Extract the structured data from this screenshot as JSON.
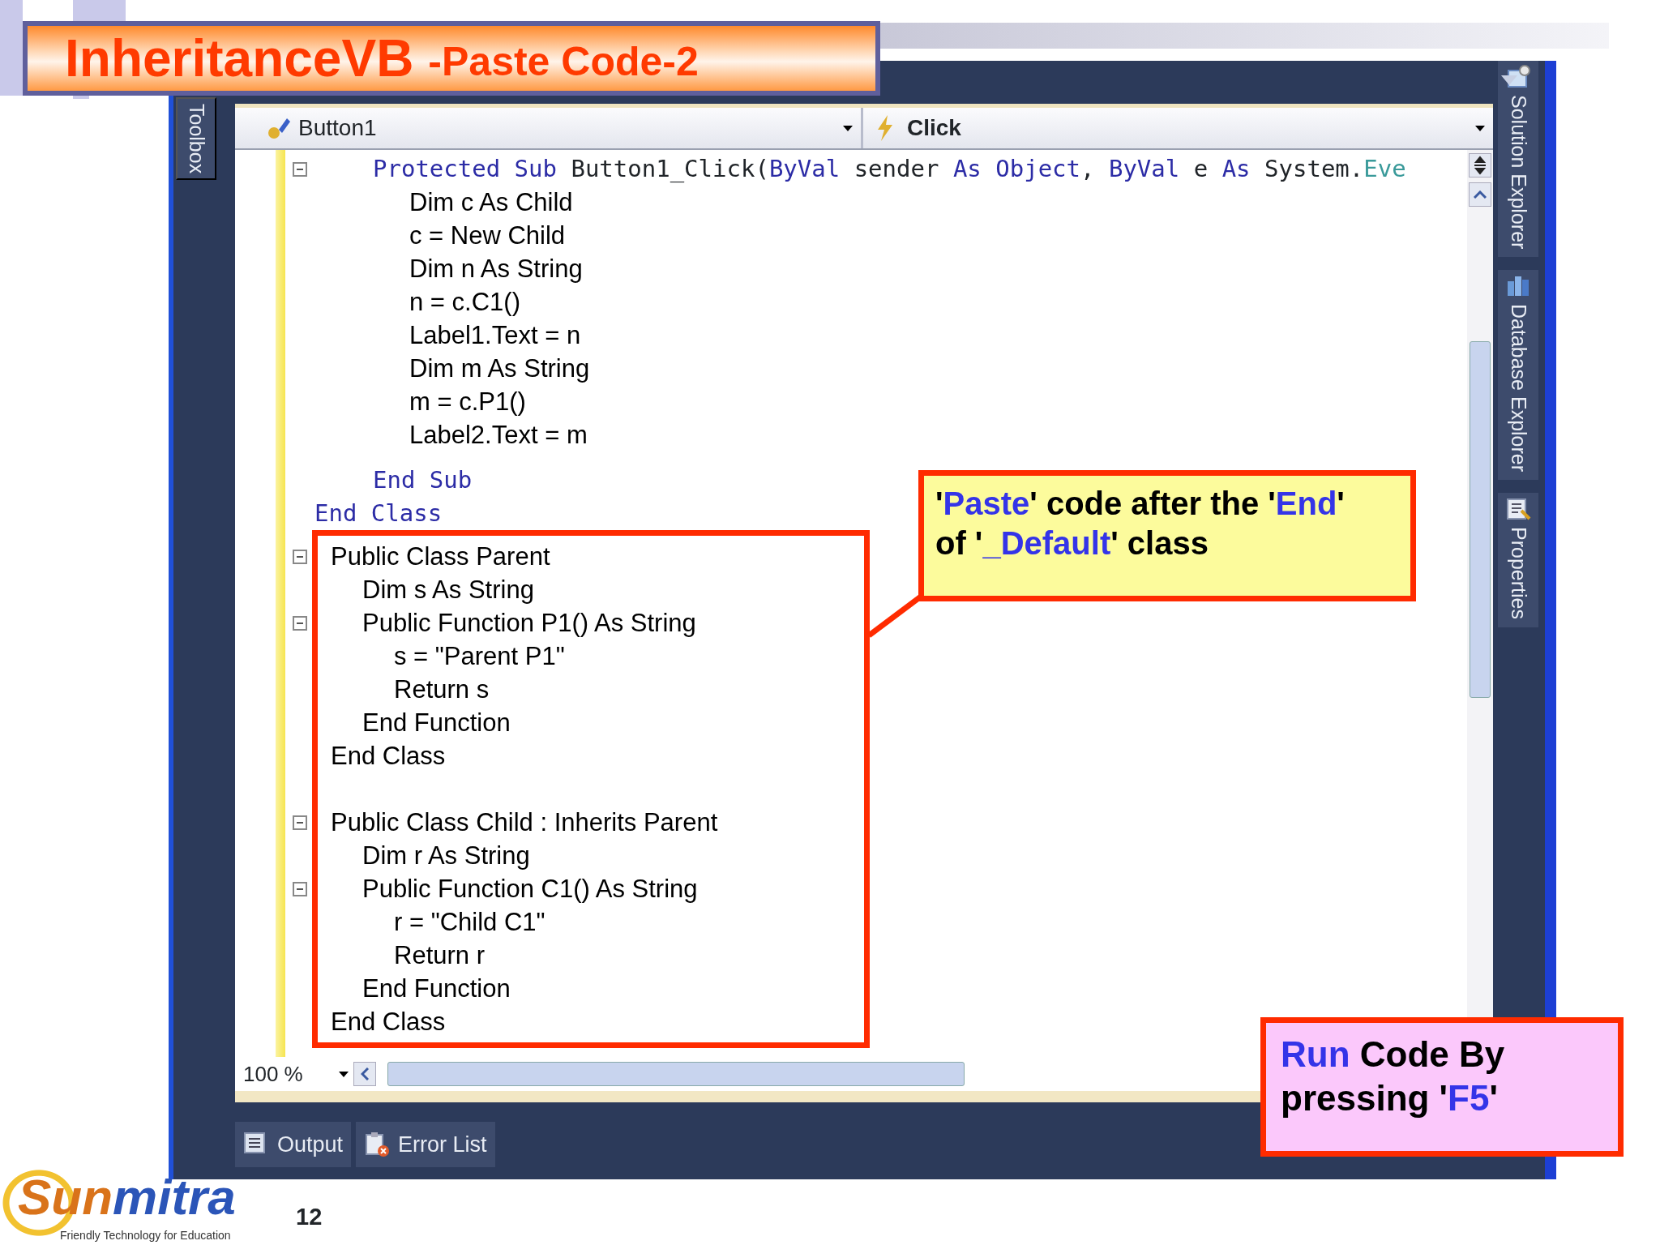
{
  "slide_title": {
    "main": "InheritanceVB",
    "sub": "-Paste Code-2"
  },
  "ide": {
    "left_tabs": [
      "Toolbox"
    ],
    "right_tabs": [
      {
        "label": "Solution Explorer",
        "kind": "solution"
      },
      {
        "label": "Database Explorer",
        "kind": "database"
      },
      {
        "label": "Properties",
        "kind": "properties"
      }
    ],
    "object_dropdown": "Button1",
    "event_dropdown": "Click",
    "method": {
      "fold": true,
      "segments": [
        {
          "text": "Protected Sub",
          "kind": "keyword"
        },
        {
          "text": " Button1_Click(",
          "kind": "plain"
        },
        {
          "text": "ByVal",
          "kind": "keyword"
        },
        {
          "text": " sender ",
          "kind": "plain"
        },
        {
          "text": "As Object",
          "kind": "keyword"
        },
        {
          "text": ", ",
          "kind": "plain"
        },
        {
          "text": "ByVal",
          "kind": "keyword"
        },
        {
          "text": " e ",
          "kind": "plain"
        },
        {
          "text": "As",
          "kind": "keyword"
        },
        {
          "text": " System.",
          "kind": "plain"
        },
        {
          "text": "Eve",
          "kind": "type"
        }
      ],
      "body": [
        "Dim c As Child",
        "c = New Child",
        "Dim n As String",
        "n = c.C1()",
        "Label1.Text = n",
        "Dim m As String",
        "m = c.P1()",
        "Label2.Text = m"
      ],
      "end_sub": "End Sub",
      "end_class": "End Class"
    },
    "pasted_code": [
      [
        {
          "text": "Public Class Parent",
          "fold": true,
          "children": [
            {
              "text": "Dim s As String"
            },
            {
              "text": "Public Function P1() As String",
              "fold": true,
              "children": [
                {
                  "text": "s = \"Parent P1\""
                },
                {
                  "text": "Return s"
                }
              ]
            },
            {
              "text": "End Function"
            }
          ]
        },
        {
          "text": "End Class"
        }
      ],
      [
        {
          "text": "Public Class Child : Inherits Parent",
          "fold": true,
          "children": [
            {
              "text": "Dim r As String"
            },
            {
              "text": "Public Function C1() As String",
              "fold": true,
              "children": [
                {
                  "text": "r = \"Child C1\""
                },
                {
                  "text": "Return r"
                }
              ]
            },
            {
              "text": "End Function"
            }
          ]
        },
        {
          "text": "End Class"
        }
      ]
    ],
    "zoom": "100 %",
    "bottom_tabs": [
      {
        "label": "Output",
        "kind": "output"
      },
      {
        "label": "Error List",
        "kind": "errors"
      }
    ]
  },
  "callouts": [
    {
      "kind": "note",
      "segments": [
        {
          "text": "'",
          "highlight": false
        },
        {
          "text": "Paste",
          "highlight": true
        },
        {
          "text": "' code after the '",
          "highlight": false
        },
        {
          "text": "End",
          "highlight": true
        },
        {
          "text": "' of '",
          "highlight": false
        },
        {
          "text": "_Default",
          "highlight": true
        },
        {
          "text": "' class",
          "highlight": false
        }
      ]
    },
    {
      "kind": "tip",
      "segments": [
        {
          "text": "Run",
          "highlight": true
        },
        {
          "text": " Code By pressing '",
          "highlight": false
        },
        {
          "text": "F5",
          "highlight": true
        },
        {
          "text": "'",
          "highlight": false
        }
      ]
    }
  ],
  "logo": {
    "name": [
      {
        "text": "Sun",
        "color": "#d9731a"
      },
      {
        "text": "mitra",
        "color": "#2b55b8"
      }
    ],
    "tagline": "Friendly Technology for Education"
  },
  "page_number": "12"
}
